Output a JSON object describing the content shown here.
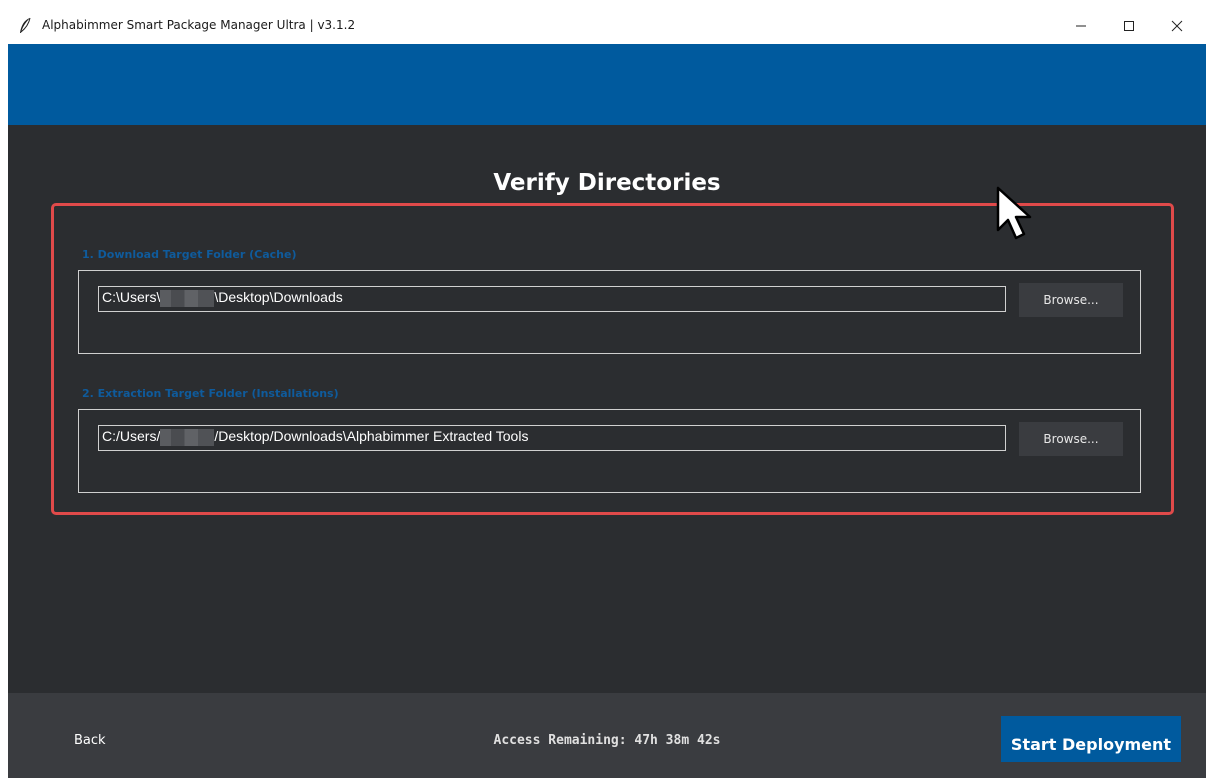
{
  "window": {
    "title": "Alphabimmer Smart Package Manager Ultra | v3.1.2",
    "app_icon": "feather-icon"
  },
  "page": {
    "title": "Verify Directories"
  },
  "download": {
    "label": "1. Download Target Folder (Cache)",
    "path_prefix": "C:\\Users\\",
    "path_suffix": "\\Desktop\\Downloads",
    "browse_label": "Browse..."
  },
  "extraction": {
    "label": "2. Extraction Target Folder (Installations)",
    "path_prefix": "C:/Users/",
    "path_suffix": "/Desktop/Downloads\\Alphabimmer Extracted Tools",
    "browse_label": "Browse..."
  },
  "footer": {
    "back_label": "Back",
    "timer_text": "Access Remaining: 47h 38m 42s",
    "start_label": "Start Deployment"
  },
  "colors": {
    "accent": "#005a9e",
    "background": "#2b2d30",
    "highlight": "#e04a4a",
    "section_label": "#0f5b9c"
  }
}
